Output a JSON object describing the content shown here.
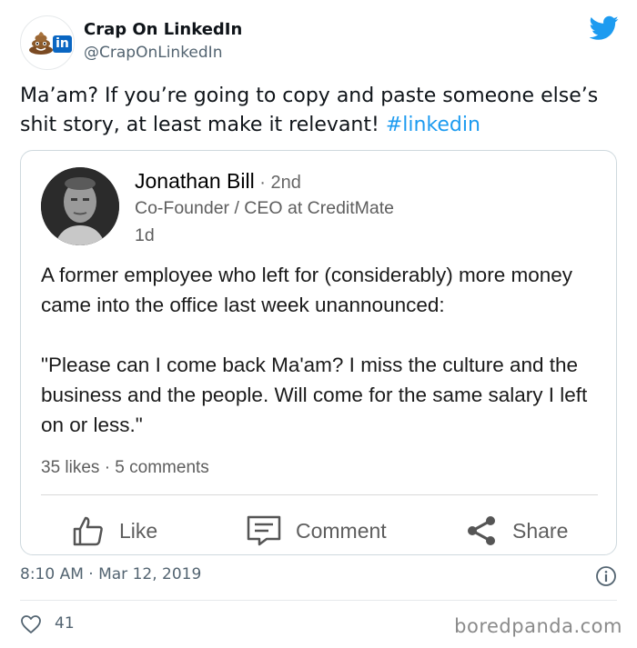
{
  "author": {
    "name": "Crap On LinkedIn",
    "handle": "@CrapOnLinkedIn",
    "avatar_icon": "poop-emoji-linkedin-logo",
    "avatar_badge": "in"
  },
  "tweet": {
    "text": "Ma’am? If you’re going to copy and paste someone else’s shit story, at least make it relevant! ",
    "hashtag": "#linkedin",
    "timestamp": "8:10 AM · Mar 12, 2019",
    "like_count": "41"
  },
  "linkedin_post": {
    "name": "Jonathan Bill",
    "degree": " · 2nd",
    "title": "Co-Founder / CEO at CreditMate",
    "time": "1d",
    "paragraphs": [
      "A former employee who left for (considerably) more money came into the office last week unannounced:",
      "\"Please can I come back Ma'am? I miss the culture and the business and the people. Will come for the same salary I left on or less.\""
    ],
    "stats": "35 likes · 5 comments",
    "actions": {
      "like": "Like",
      "comment": "Comment",
      "share": "Share"
    }
  },
  "watermark": "boredpanda.com",
  "colors": {
    "twitter_blue": "#1d9bf0",
    "linkedin_blue": "#0a66c2",
    "secondary_text": "#536471"
  }
}
